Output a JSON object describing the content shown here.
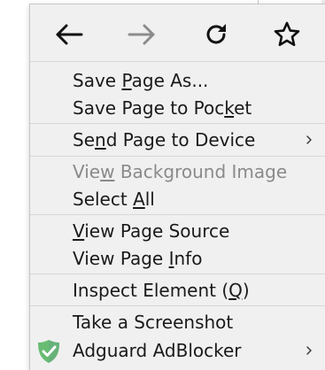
{
  "nav": {
    "back_label": "Back",
    "forward_label": "Forward",
    "reload_label": "Reload",
    "bookmark_label": "Bookmark this page"
  },
  "menu": {
    "save_page_as": {
      "before": "Save ",
      "key": "P",
      "after": "age As..."
    },
    "save_to_pocket": {
      "before": "Save Page to Poc",
      "key": "k",
      "after": "et"
    },
    "send_to_device": {
      "before": "Se",
      "key": "n",
      "after": "d Page to Device"
    },
    "view_background_image": {
      "before": "Vie",
      "key": "w",
      "after": " Background Image"
    },
    "select_all": {
      "before": "Select ",
      "key": "A",
      "after": "ll"
    },
    "view_page_source": {
      "before": "",
      "key": "V",
      "after": "iew Page Source"
    },
    "view_page_info": {
      "before": "View Page ",
      "key": "I",
      "after": "nfo"
    },
    "inspect_element": {
      "before": "Inspect Element (",
      "key": "Q",
      "after": ")"
    },
    "take_screenshot": {
      "label": "Take a Screenshot"
    },
    "adguard": {
      "label": "Adguard AdBlocker"
    }
  },
  "colors": {
    "menu_bg": "#f0f0f0",
    "text": "#1a1a1a",
    "disabled_text": "#8a8a8a",
    "separator": "#d7d7d7",
    "adguard_green": "#68bc71"
  },
  "icons": {
    "back": "arrow-left-icon",
    "forward": "arrow-right-icon",
    "reload": "reload-icon",
    "bookmark": "star-icon",
    "submenu": "chevron-right-icon",
    "adguard": "adguard-shield-icon"
  }
}
